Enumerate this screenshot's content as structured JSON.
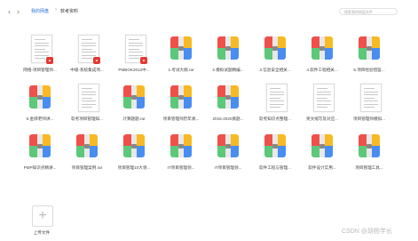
{
  "breadcrumb": {
    "root": "我的网盘",
    "current": "软考资料"
  },
  "search": {
    "placeholder": "搜索我的网盘文件"
  },
  "files": [
    {
      "name": "网络-项目管理师...",
      "type": "pdf"
    },
    {
      "name": "中级-系统集成项...",
      "type": "pdf"
    },
    {
      "name": "PMBOK2012中...",
      "type": "pdf"
    },
    {
      "name": "1.考试大纲.rar",
      "type": "rar"
    },
    {
      "name": "2.模拟试题精编...",
      "type": "rar"
    },
    {
      "name": "3.信息安全相关...",
      "type": "rar"
    },
    {
      "name": "4.软件工程相关...",
      "type": "rar"
    },
    {
      "name": "5.项目经验借鉴...",
      "type": "rar"
    },
    {
      "name": "6.金牌老师讲...",
      "type": "rar"
    },
    {
      "name": "软考项目管理知...",
      "type": "doc"
    },
    {
      "name": "计算题题.rar",
      "type": "rar"
    },
    {
      "name": "项目管理师历年真...",
      "type": "rar"
    },
    {
      "name": "2015-2020真题...",
      "type": "rar"
    },
    {
      "name": "软考知识点整理...",
      "type": "doc"
    },
    {
      "name": "英文缩写及对应...",
      "type": "doc"
    },
    {
      "name": "项目管理师模拟...",
      "type": "doc"
    },
    {
      "name": "PMP知识点精讲...",
      "type": "rar"
    },
    {
      "name": "项目管理案例.rar",
      "type": "rar"
    },
    {
      "name": "项目管理10大领...",
      "type": "rar"
    },
    {
      "name": "IT项目管理领...",
      "type": "rar"
    },
    {
      "name": "IT项目管理领...",
      "type": "rar"
    },
    {
      "name": "软件工程与管理...",
      "type": "rar"
    },
    {
      "name": "软件设计实用...",
      "type": "rar"
    },
    {
      "name": "项目管理工具...",
      "type": "rar"
    }
  ],
  "upload": {
    "label": "上传文件",
    "icon": "plus-icon"
  },
  "watermark": "CSDN @胡杨学长",
  "colors": {
    "link": "#2f75d6",
    "rar_red": "#f0504a",
    "rar_yellow": "#f7b924",
    "rar_green": "#5cc87a",
    "rar_blue": "#4a8df0",
    "pdf_badge": "#e53935"
  }
}
